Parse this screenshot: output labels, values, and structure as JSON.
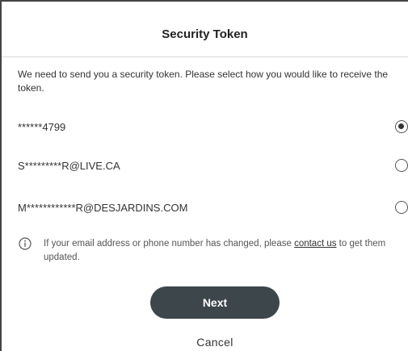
{
  "dialog": {
    "title": "Security Token",
    "intro": "We need to send you a security token. Please select how you would like to receive the token."
  },
  "options": [
    {
      "label": "******4799",
      "selected": true
    },
    {
      "label": "S*********R@LIVE.CA",
      "selected": false
    },
    {
      "label": "M************R@DESJARDINS.COM",
      "selected": false
    }
  ],
  "info": {
    "icon": "info-icon",
    "text_before": "If your email address or phone number has changed, please ",
    "link": "contact us",
    "text_after": " to get them updated."
  },
  "actions": {
    "next_label": "Next",
    "cancel_label": "Cancel"
  },
  "colors": {
    "primary_button": "#3d464b",
    "text": "#333333",
    "divider": "#d9d9d9"
  }
}
